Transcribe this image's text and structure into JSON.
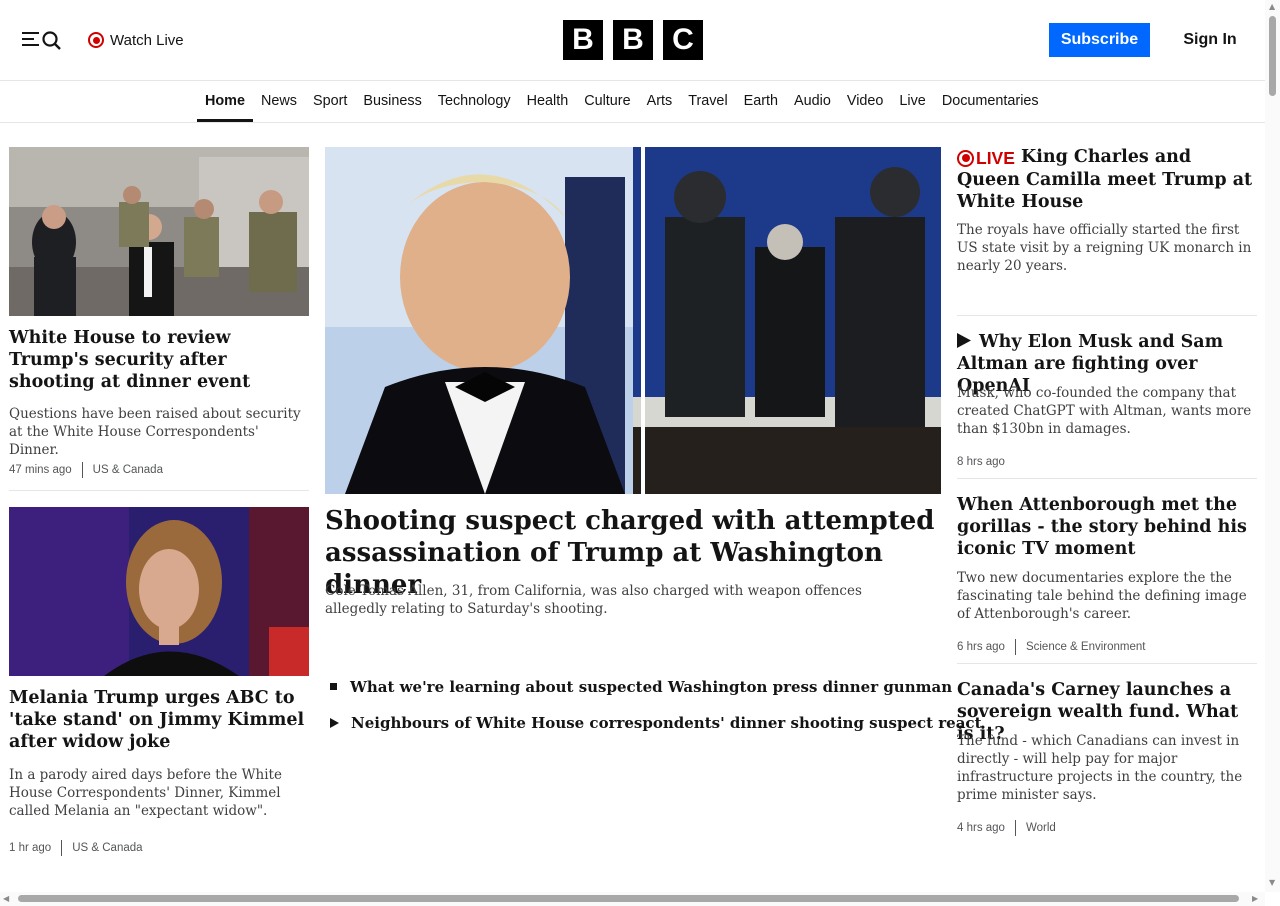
{
  "header": {
    "watch_live": "Watch Live",
    "logo_letters": [
      "B",
      "B",
      "C"
    ],
    "subscribe": "Subscribe",
    "sign_in": "Sign In"
  },
  "nav": {
    "items": [
      "Home",
      "News",
      "Sport",
      "Business",
      "Technology",
      "Health",
      "Culture",
      "Arts",
      "Travel",
      "Earth",
      "Audio",
      "Video",
      "Live",
      "Documentaries"
    ],
    "active": "Home"
  },
  "left": {
    "story1": {
      "headline": "White House to review Trump's security after shooting at dinner event",
      "summary": "Questions have been raised about security at the White House Correspondents' Dinner.",
      "time": "47 mins ago",
      "section": "US & Canada"
    },
    "story2": {
      "headline": "Melania Trump urges ABC to 'take stand' on Jimmy Kimmel after widow joke",
      "summary": "In a parody aired days before the White House Correspondents' Dinner, Kimmel called Melania an \"expectant widow\".",
      "time": "1 hr ago",
      "section": "US & Canada"
    }
  },
  "center": {
    "headline": "Shooting suspect charged with attempted assassination of Trump at Washington dinner",
    "summary": "Cole Tomas Allen, 31, from California, was also charged with weapon offences allegedly relating to Saturday's shooting.",
    "related": [
      {
        "icon": "square-bullet-icon",
        "text": "What we're learning about suspected Washington press dinner gunman"
      },
      {
        "icon": "play-icon",
        "text": "Neighbours of White House correspondents' dinner shooting suspect react"
      }
    ]
  },
  "right": {
    "story1": {
      "live_label": "LIVE",
      "headline": "King Charles and Queen Camilla meet Trump at White House",
      "summary": "The royals have officially started the first US state visit by a reigning UK monarch in nearly 20 years."
    },
    "story2": {
      "headline": "Why Elon Musk and Sam Altman are fighting over OpenAI",
      "summary": "Musk, who co-founded the company that created ChatGPT with Altman, wants more than $130bn in damages.",
      "time": "8 hrs ago"
    },
    "story3": {
      "headline": "When Attenborough met the gorillas - the story behind his iconic TV moment",
      "summary": "Two new documentaries explore the the fascinating tale behind the defining image of Attenborough's career.",
      "time": "6 hrs ago",
      "section": "Science & Environment"
    },
    "story4": {
      "headline": "Canada's Carney launches a sovereign wealth fund. What is it?",
      "summary": "The fund - which Canadians can invest in directly - will help pay for major infrastructure projects in the country, the prime minister says.",
      "time": "4 hrs ago",
      "section": "World"
    }
  },
  "colors": {
    "accent_blue": "#0068ff",
    "live_red": "#d10000",
    "text": "#141414"
  }
}
